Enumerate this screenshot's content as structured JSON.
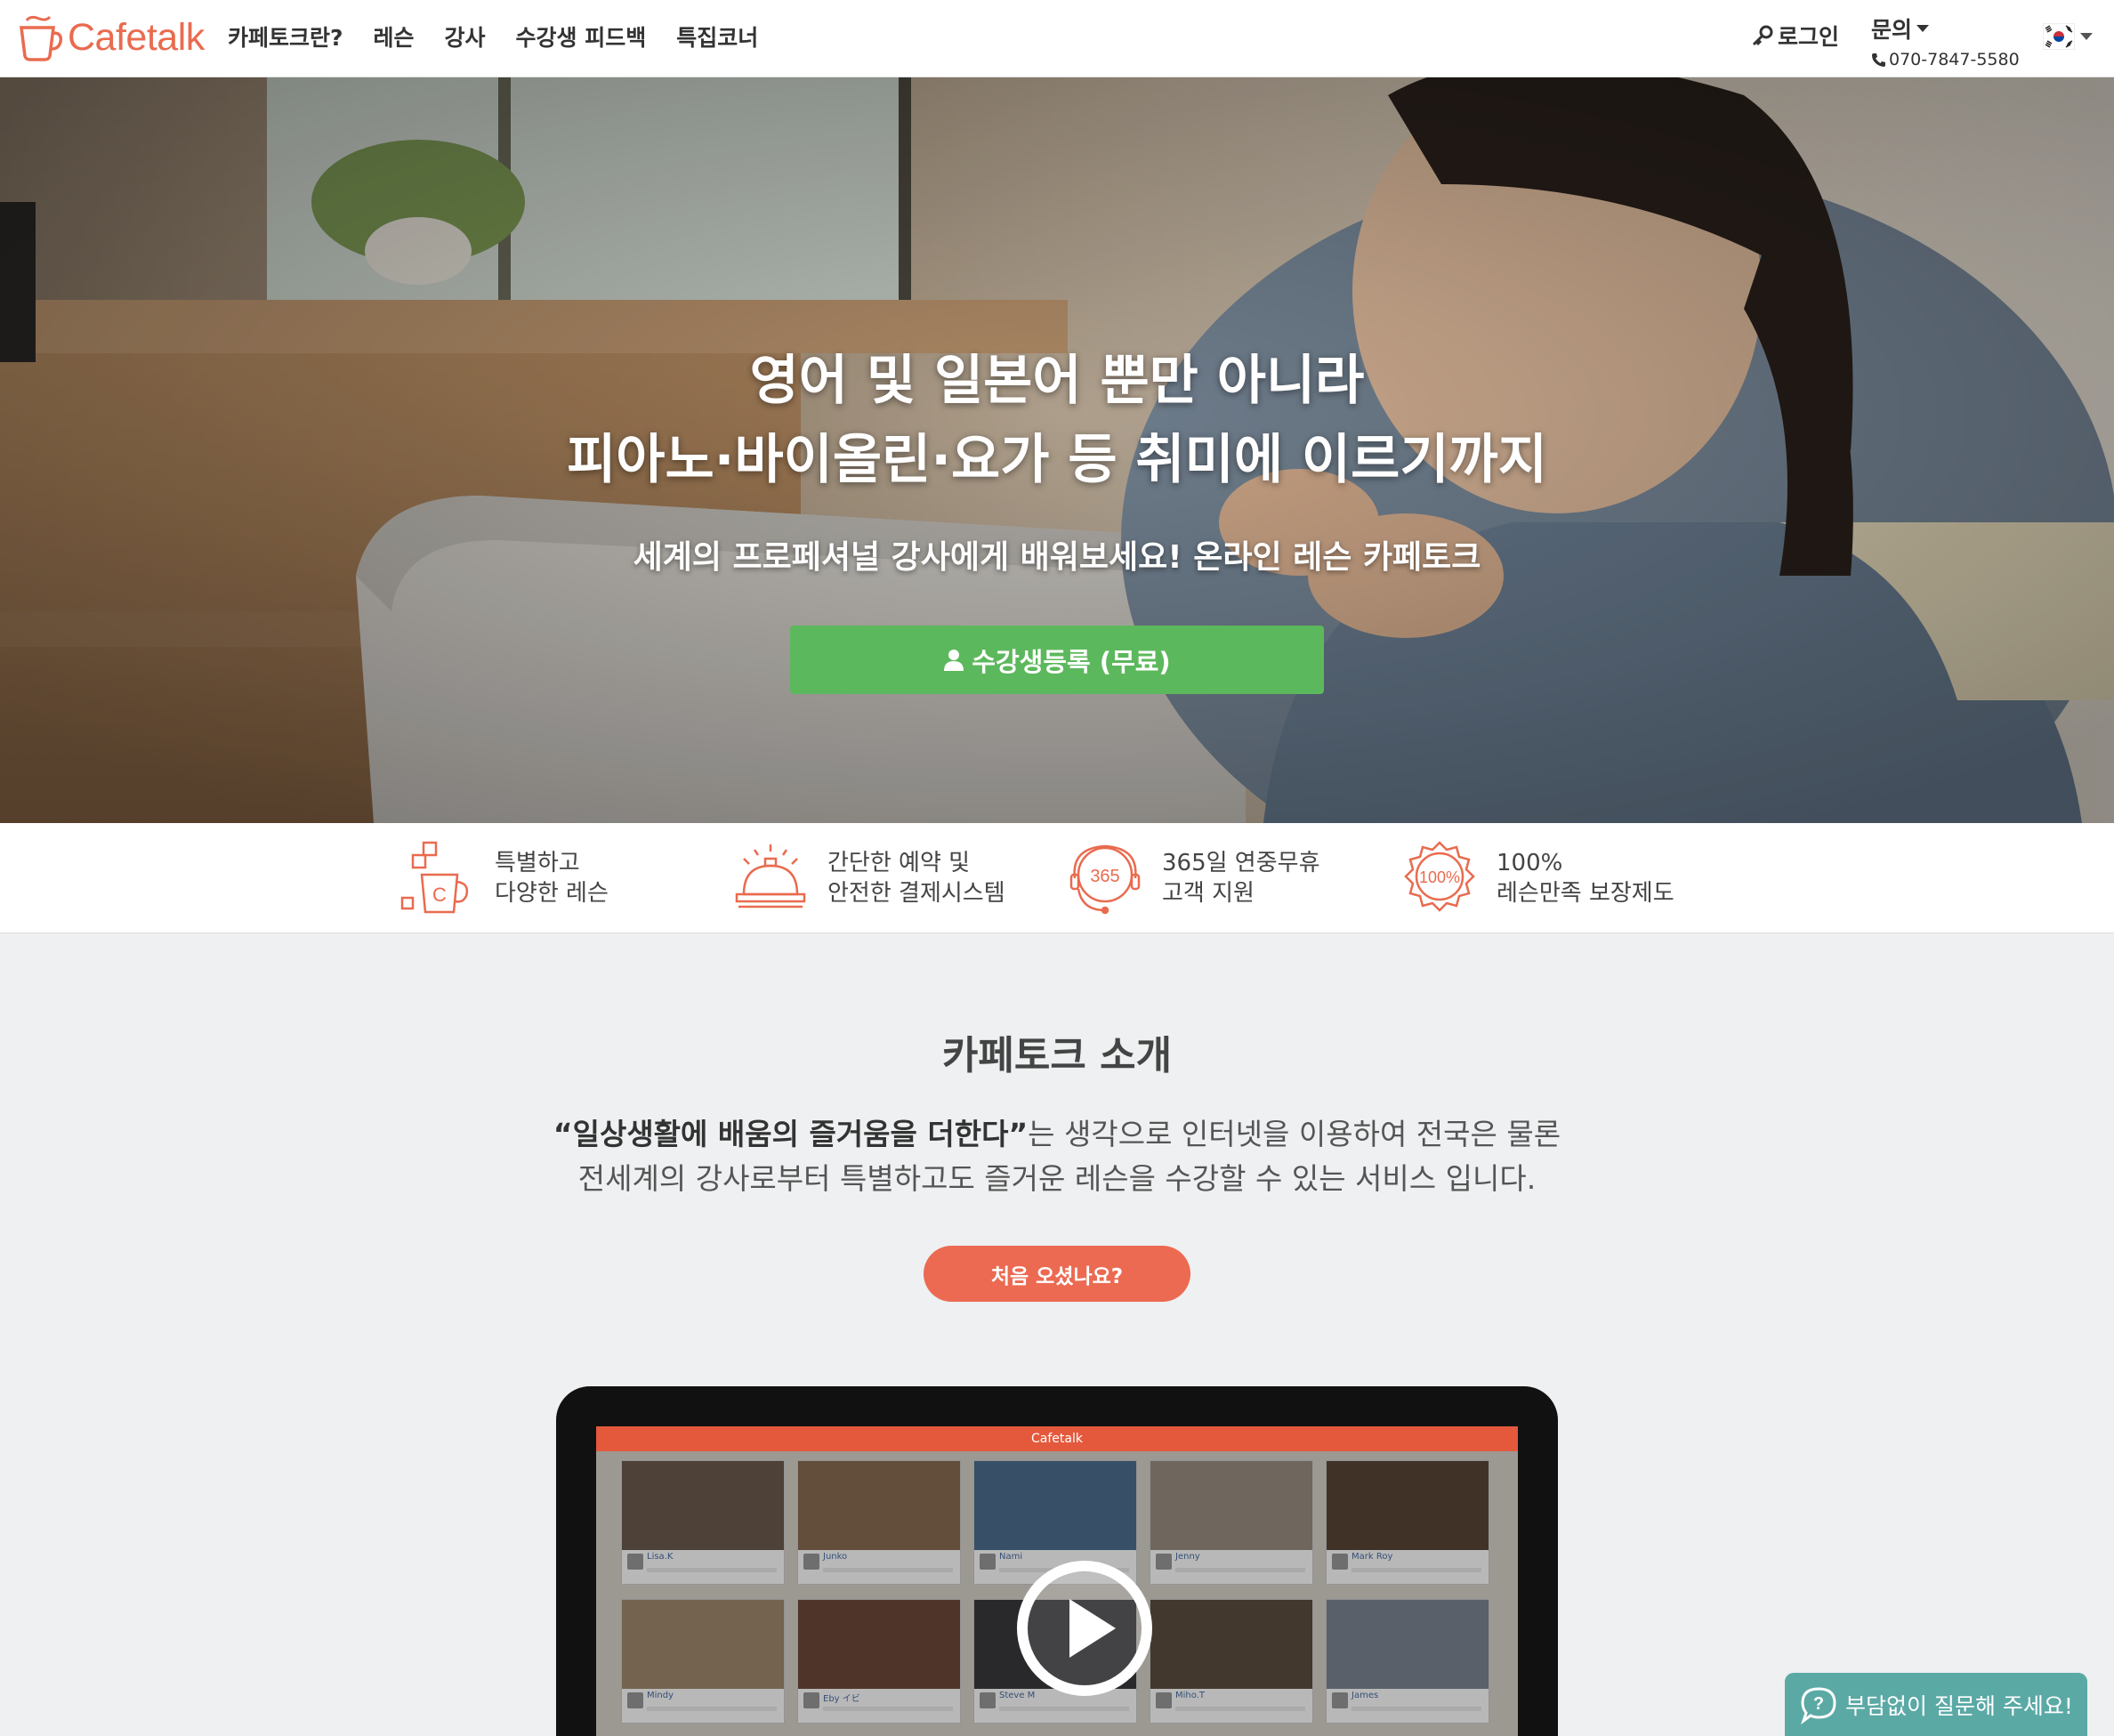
{
  "header": {
    "logo_text": "Cafetalk",
    "nav": [
      "카페토크란?",
      "레슨",
      "강사",
      "수강생 피드백",
      "특집코너"
    ],
    "login": "로그인",
    "contact_label": "문의",
    "phone": "070-7847-5580",
    "language_flag": "korea-flag-icon"
  },
  "hero": {
    "title_line1": "영어 및 일본어 뿐만 아니라",
    "title_line2": "피아노·바이올린·요가 등 취미에 이르기까지",
    "subtitle": "세계의 프로페셔널 강사에게 배워보세요! 온라인 레슨 카페토크",
    "cta": "수강생등록 (무료)"
  },
  "features": [
    {
      "icon": "cup-icon",
      "line1": "특별하고",
      "line2": "다양한 레슨"
    },
    {
      "icon": "bell-icon",
      "line1": "간단한 예약 및",
      "line2": "안전한 결제시스템"
    },
    {
      "icon": "support-365-icon",
      "badge": "365",
      "line1": "365일 연중무휴",
      "line2": "고객 지원"
    },
    {
      "icon": "guarantee-badge-icon",
      "badge": "100%",
      "line1": "100%",
      "line2": "레슨만족 보장제도"
    }
  ],
  "intro": {
    "title": "카페토크 소개",
    "quote": "“일상생활에 배움의 즐거움을 더한다”",
    "desc_rest": "는 생각으로 인터넷을 이용하여 전국은 물론",
    "desc_line2": "전세계의 강사로부터 특별하고도 즐거운 레슨을 수강할 수 있는 서비스 입니다.",
    "button": "처음 오셨나요?"
  },
  "video": {
    "screen_logo": "Cafetalk",
    "tutors": [
      "Lisa.K",
      "Junko",
      "Nami",
      "Jenny",
      "Mark Roy",
      "Mindy",
      "Eby イビ",
      "Steve M",
      "Miho.T",
      "James"
    ]
  },
  "chat": {
    "label": "부담없이 질문해 주세요!"
  },
  "colors": {
    "brand": "#e96b4f",
    "cta_green": "#5cb85c",
    "chat_teal": "#5aa9a5"
  }
}
